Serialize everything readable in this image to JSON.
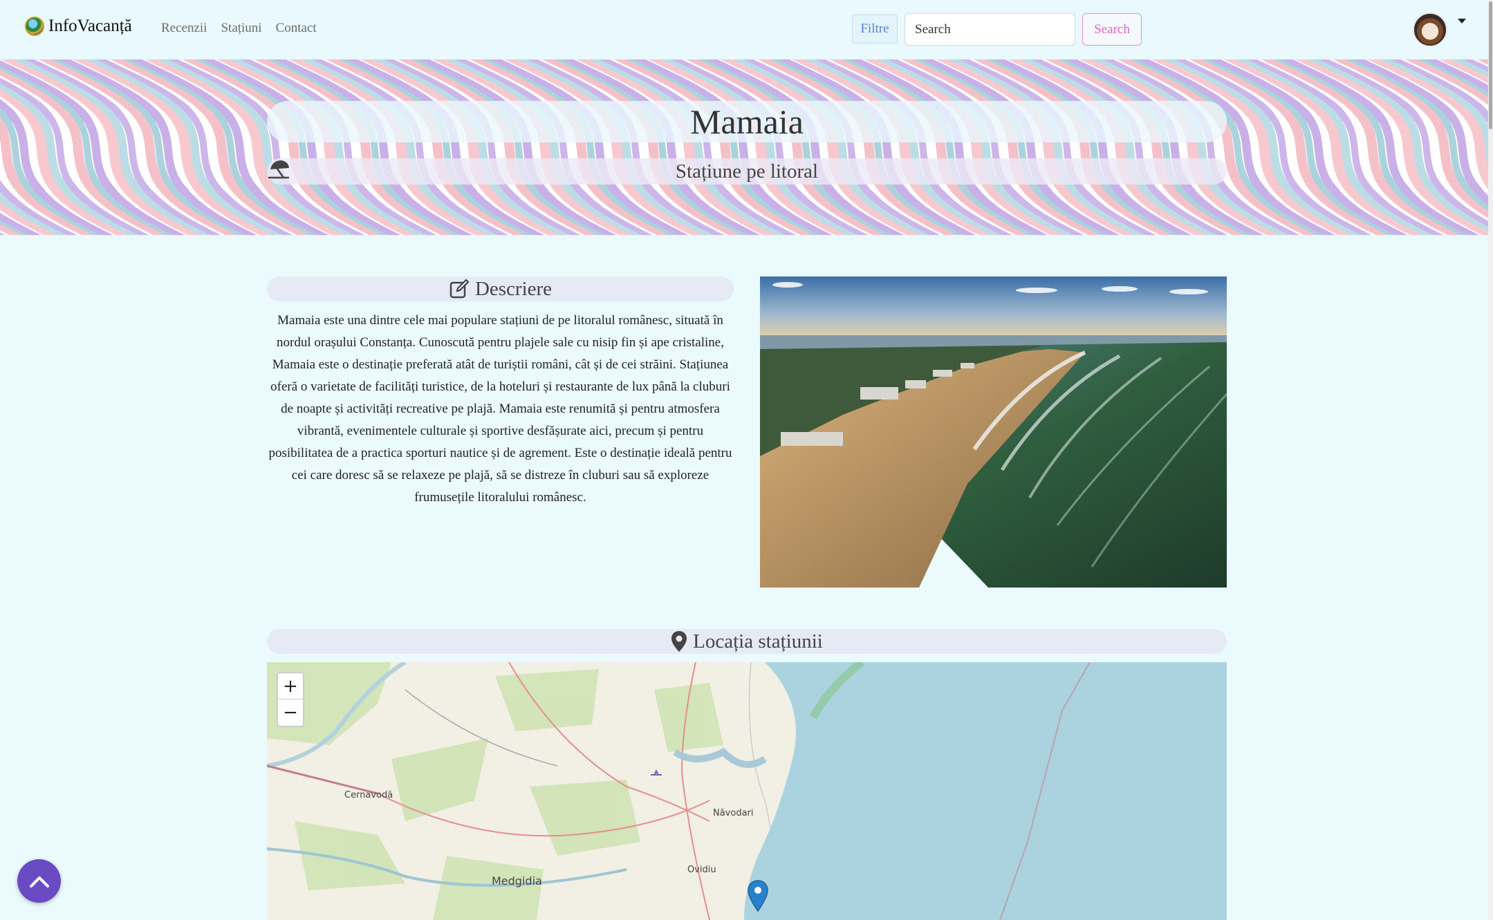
{
  "navbar": {
    "brand": "InfoVacanță",
    "links": [
      "Recenzii",
      "Stațiuni",
      "Contact"
    ],
    "filter_label": "Filtre",
    "search_placeholder": "Search",
    "search_button": "Search"
  },
  "hero": {
    "title": "Mamaia",
    "subtitle": "Stațiune pe litoral",
    "subtitle_icon": "beach-umbrella-icon"
  },
  "description": {
    "heading": "Descriere",
    "heading_icon": "edit-icon",
    "text": "Mamaia este una dintre cele mai populare stațiuni de pe litoralul românesc, situată în nordul orașului Constanța. Cunoscută pentru plajele sale cu nisip fin și ape cristaline, Mamaia este o destinație preferată atât de turiștii români, cât și de cei străini. Stațiunea oferă o varietate de facilități turistice, de la hoteluri și restaurante de lux până la cluburi de noapte și activități recreative pe plajă. Mamaia este renumită și pentru atmosfera vibrantă, evenimentele culturale și sportive desfășurate aici, precum și pentru posibilitatea de a practica sporturi nautice și de agrement. Este o destinație ideală pentru cei care doresc să se relaxeze pe plajă, să se distreze în cluburi sau să exploreze frumusețile litoralului românesc."
  },
  "location": {
    "heading": "Locația stațiunii",
    "heading_icon": "map-pin-icon",
    "zoom_in": "+",
    "zoom_out": "−",
    "places": [
      "Cernavodă",
      "Năvodari",
      "Ovidiu",
      "Medgidia"
    ]
  },
  "colors": {
    "page_bg": "#eafafd",
    "accent_purple": "#6a4bc4",
    "search_pink": "#dd66c8",
    "filter_blue": "#5b7fd6"
  }
}
